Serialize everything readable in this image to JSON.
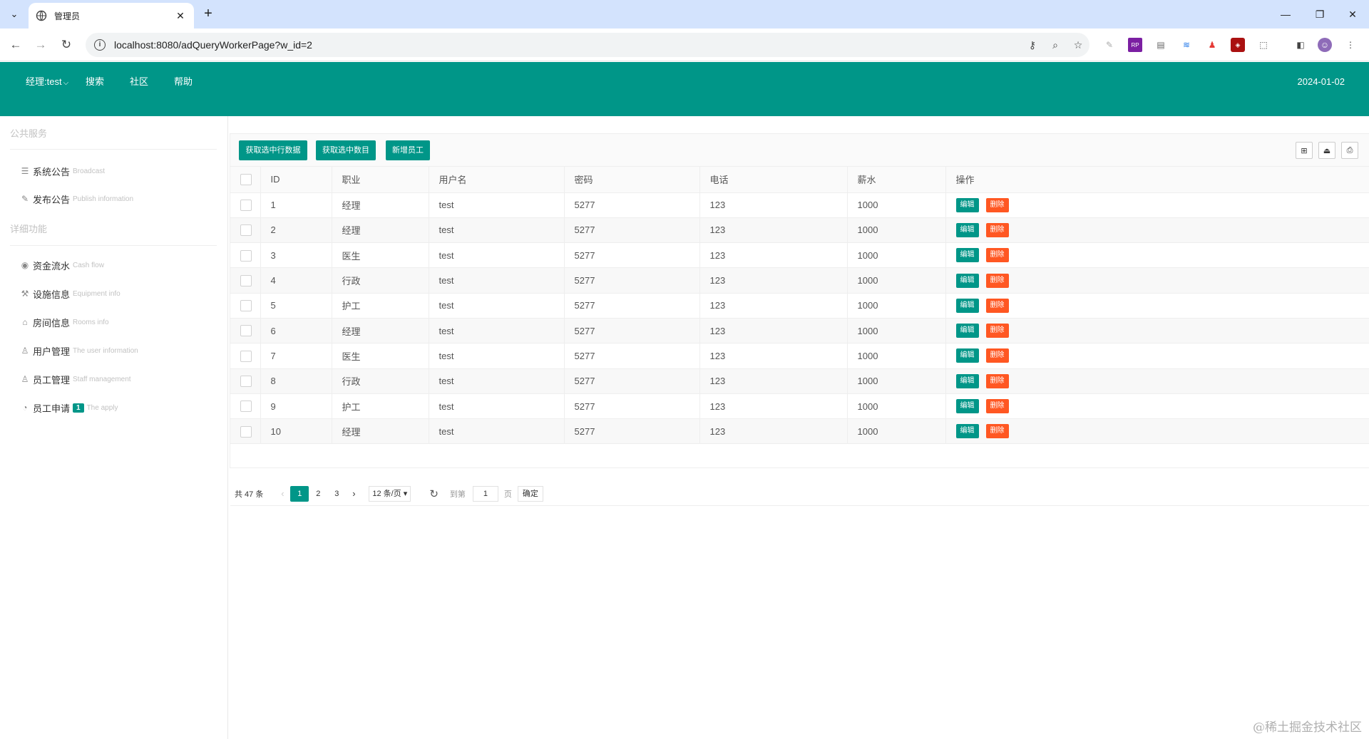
{
  "browser": {
    "tab_title": "管理员",
    "url": "localhost:8080/adQueryWorkerPage?w_id=2"
  },
  "header": {
    "nav": [
      "经理:test",
      "搜索",
      "社区",
      "帮助"
    ],
    "date": "2024-01-02"
  },
  "sidebar": {
    "section1": "公共服务",
    "section2": "详细功能",
    "items": [
      {
        "label": "系统公告",
        "sub": "Broadcast",
        "icon": "list-icon"
      },
      {
        "label": "发布公告",
        "sub": "Publish information",
        "icon": "edit-icon"
      },
      {
        "label": "资金流水",
        "sub": "Cash flow",
        "icon": "coin-icon"
      },
      {
        "label": "设施信息",
        "sub": "Equipment info",
        "icon": "tools-icon"
      },
      {
        "label": "房间信息",
        "sub": "Rooms info",
        "icon": "home-icon"
      },
      {
        "label": "用户管理",
        "sub": "The user information",
        "icon": "users-icon"
      },
      {
        "label": "员工管理",
        "sub": "Staff management",
        "icon": "user-icon"
      },
      {
        "label": "员工申请",
        "sub": "The apply",
        "icon": "bell-icon",
        "badge": "1"
      }
    ]
  },
  "toolbar": {
    "btn_get_rows": "获取选中行数据",
    "btn_get_count": "获取选中数目",
    "btn_add": "新增员工"
  },
  "table": {
    "columns": [
      "ID",
      "职业",
      "用户名",
      "密码",
      "电话",
      "薪水",
      "操作"
    ],
    "rows": [
      [
        "1",
        "经理",
        "test",
        "5277",
        "123",
        "1000"
      ],
      [
        "2",
        "经理",
        "test",
        "5277",
        "123",
        "1000"
      ],
      [
        "3",
        "医生",
        "test",
        "5277",
        "123",
        "1000"
      ],
      [
        "4",
        "行政",
        "test",
        "5277",
        "123",
        "1000"
      ],
      [
        "5",
        "护工",
        "test",
        "5277",
        "123",
        "1000"
      ],
      [
        "6",
        "经理",
        "test",
        "5277",
        "123",
        "1000"
      ],
      [
        "7",
        "医生",
        "test",
        "5277",
        "123",
        "1000"
      ],
      [
        "8",
        "行政",
        "test",
        "5277",
        "123",
        "1000"
      ],
      [
        "9",
        "护工",
        "test",
        "5277",
        "123",
        "1000"
      ],
      [
        "10",
        "经理",
        "test",
        "5277",
        "123",
        "1000"
      ]
    ],
    "edit_label": "编辑",
    "delete_label": "删除"
  },
  "pager": {
    "total": "共 47 条",
    "pages": [
      "1",
      "2",
      "3"
    ],
    "current": "1",
    "page_size": "12 条/页",
    "goto_label": "到第",
    "goto_value": "1",
    "page_label": "页",
    "confirm": "确定"
  },
  "watermark": "@稀土掘金技术社区",
  "colors": {
    "primary": "#009688",
    "danger": "#ff5722",
    "chrome": "#d3e3fd"
  }
}
